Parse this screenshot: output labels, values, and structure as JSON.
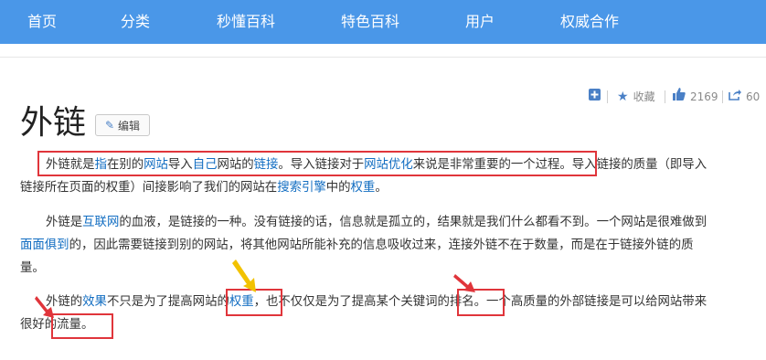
{
  "nav": {
    "items": [
      "首页",
      "分类",
      "秒懂百科",
      "特色百科",
      "用户",
      "权威合作"
    ]
  },
  "actions": {
    "favorite": "收藏",
    "likes": "2169",
    "shares": "60"
  },
  "title": "外链",
  "edit_label": "编辑",
  "p1": {
    "l1": [
      {
        "t": "外链就是",
        "link": false
      },
      {
        "t": "指",
        "link": true
      },
      {
        "t": "在别的",
        "link": false
      },
      {
        "t": "网站",
        "link": true
      },
      {
        "t": "导入",
        "link": false
      },
      {
        "t": "自己",
        "link": true
      },
      {
        "t": "网站的",
        "link": false
      },
      {
        "t": "链接",
        "link": true
      },
      {
        "t": "。导入链接对于",
        "link": false
      },
      {
        "t": "网站优化",
        "link": true
      },
      {
        "t": "来说是非常重要的一个过程。导入链接的质量（即导入",
        "link": false
      }
    ],
    "l2": [
      {
        "t": "链接所在页面的权重）间接影响了我们的网站在",
        "link": false
      },
      {
        "t": "搜索引擎",
        "link": true
      },
      {
        "t": "中的",
        "link": false
      },
      {
        "t": "权重",
        "link": true
      },
      {
        "t": "。",
        "link": false
      }
    ]
  },
  "p2": {
    "l1": [
      {
        "t": "外链是",
        "link": false
      },
      {
        "t": "互联网",
        "link": true
      },
      {
        "t": "的血液，是链接的一种。没有链接的话，信息就是孤立的，结果就是我们什么都看不到。一个网站是很难做到",
        "link": false
      }
    ],
    "l2": [
      {
        "t": "面面俱到",
        "link": true
      },
      {
        "t": "的，因此需要链接到别的网站，将其他网站所能补充的信息吸收过来，连接外链不在于数量，而是在于链接外链的质",
        "link": false
      }
    ],
    "l3": [
      {
        "t": "量。",
        "link": false
      }
    ]
  },
  "p3": {
    "l1": [
      {
        "t": "外链的",
        "link": false
      },
      {
        "t": "效果",
        "link": true
      },
      {
        "t": "不只是为了提高网站的",
        "link": false
      },
      {
        "t": "权重",
        "link": true
      },
      {
        "t": "，也不仅仅是为了提高某个关键词的排名。一个高质量的外部链接是可以给网站带来",
        "link": false
      }
    ],
    "l2": [
      {
        "t": "很好的流量。",
        "link": false
      }
    ]
  },
  "colors": {
    "nav_bg": "#4a97e8",
    "link": "#136ec2",
    "highlight": "#e0353b",
    "arrow_red": "#e0353b",
    "arrow_yellow": "#f2c200"
  }
}
